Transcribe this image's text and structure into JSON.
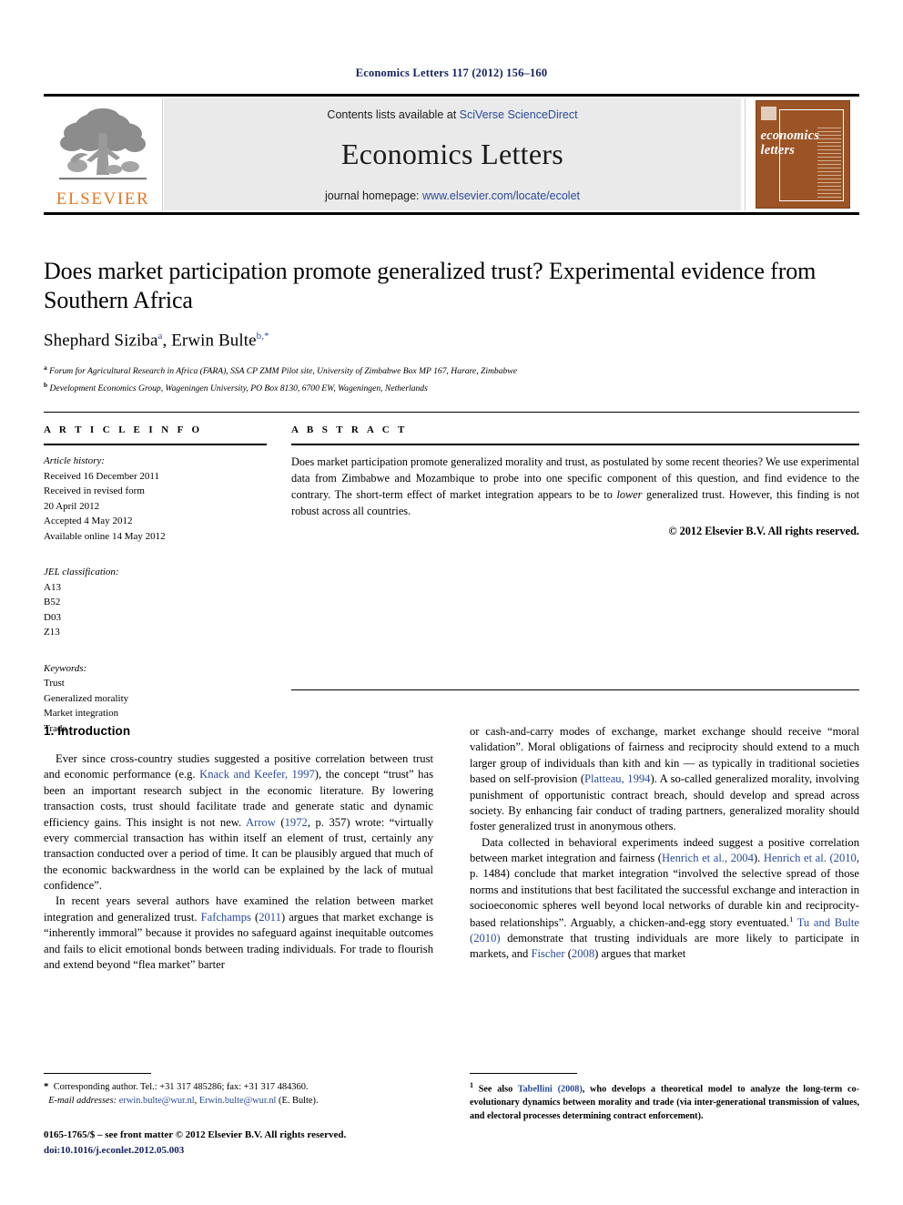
{
  "running_head": "Economics Letters 117 (2012) 156–160",
  "masthead": {
    "publisher_logo_text": "ELSEVIER",
    "contents_prefix": "Contents lists available at ",
    "contents_link": "SciVerse ScienceDirect",
    "journal_title": "Economics Letters",
    "homepage_prefix": "journal homepage: ",
    "homepage_url": "www.elsevier.com/locate/ecolet",
    "cover_title_line1": "economics",
    "cover_title_line2": "letters",
    "cover_color": "#9c5426",
    "link_color": "#2a4b9b",
    "logo_color": "#E87722"
  },
  "article": {
    "title": "Does market participation promote generalized trust? Experimental evidence from Southern Africa",
    "authors_plain": "Shephard Siziba a, Erwin Bulte b,*",
    "author1_name": "Shephard Siziba",
    "author1_sup": "a",
    "author2_name": "Erwin Bulte",
    "author2_sup": "b,*",
    "affiliation_a_marker": "a",
    "affiliation_a": "Forum for Agricultural Research in Africa (FARA), SSA CP ZMM Pilot site, University of Zimbabwe Box MP 167, Harare, Zimbabwe",
    "affiliation_b_marker": "b",
    "affiliation_b": "Development Economics Group, Wageningen University, PO Box 8130, 6700 EW, Wageningen, Netherlands"
  },
  "article_info": {
    "heading": "A R T I C L E   I N F O",
    "history_label": "Article history:",
    "history": [
      "Received 16 December 2011",
      "Received in revised form",
      "20 April 2012",
      "Accepted 4 May 2012",
      "Available online 14 May 2012"
    ],
    "jel_label": "JEL classification:",
    "jel_codes": [
      "A13",
      "B52",
      "D03",
      "Z13"
    ],
    "keywords_label": "Keywords:",
    "keywords": [
      "Trust",
      "Generalized morality",
      "Market integration",
      "Trade"
    ]
  },
  "abstract": {
    "heading": "A B S T R A C T",
    "text_part1": "Does market participation promote generalized morality and trust, as postulated by some recent theories? We use experimental data from Zimbabwe and Mozambique to probe into one specific component of this question, and find evidence to the contrary. The short-term effect of market integration appears to be to ",
    "text_italic": "lower",
    "text_part2": " generalized trust. However, this finding is not robust across all countries.",
    "copyright": "© 2012 Elsevier B.V. All rights reserved."
  },
  "body": {
    "section1_heading": "1. Introduction",
    "left_para1": {
      "seg1": "Ever since cross-country studies suggested a positive correlation between trust and economic performance (e.g. ",
      "cit1": "Knack and Keefer, 1997",
      "seg2": "), the concept “trust” has been an important research subject in the economic literature. By lowering transaction costs, trust should facilitate trade and generate static and dynamic efficiency gains. This insight is not new. ",
      "cit2": "Arrow",
      "seg3": " (",
      "cit3": "1972",
      "seg4": ", p. 357) wrote: “virtually every commercial transaction has within itself an element of trust, certainly any transaction conducted over a period of time. It can be plausibly argued that much of the economic backwardness in the world can be explained by the lack of mutual confidence”."
    },
    "left_para2": {
      "seg1": "In recent years several authors have examined the relation between market integration and generalized trust. ",
      "cit1": "Fafchamps",
      "seg2": " (",
      "cit2": "2011",
      "seg3": ") argues that market exchange is “inherently immoral” because it provides no safeguard against inequitable outcomes and fails to elicit emotional bonds between trading individuals. For trade to flourish and extend beyond “flea market” barter"
    },
    "right_para1": {
      "seg1": "or cash-and-carry modes of exchange, market exchange should receive “moral validation”. Moral obligations of fairness and reciprocity should extend to a much larger group of individuals than kith and kin — as typically in traditional societies based on self-provision (",
      "cit1": "Platteau, 1994",
      "seg2": "). A so-called generalized morality, involving punishment of opportunistic contract breach, should develop and spread across society. By enhancing fair conduct of trading partners, generalized morality should foster generalized trust in anonymous others."
    },
    "right_para2": {
      "seg1": "Data collected in behavioral experiments indeed suggest a positive correlation between market integration and fairness (",
      "cit1": "Henrich et al., 2004",
      "seg2": "). ",
      "cit2": "Henrich et al. (2010",
      "seg3": ", p. 1484) conclude that market integration “involved the selective spread of those norms and institutions that best facilitated the successful exchange and interaction in socioeconomic spheres well beyond local networks of durable kin and reciprocity-based relationships”. Arguably, a chicken-and-egg story eventuated.",
      "fnref": "1",
      "seg4": " ",
      "cit3": "Tu and Bulte (2010)",
      "seg5": " demonstrate that trusting individuals are more likely to participate in markets, and ",
      "cit4": "Fischer",
      "seg6": " (",
      "cit5": "2008",
      "seg7": ") argues that market"
    }
  },
  "footer": {
    "corresponding_marker": "*",
    "corresponding_text": "Corresponding author. Tel.: +31 317 485286; fax: +31 317 484360.",
    "email_label": "E-mail addresses:",
    "email1": "erwin.bulte@wur.nl",
    "email_sep": ", ",
    "email2": "Erwin.bulte@wur.nl",
    "email_suffix": " (E. Bulte).",
    "imprint_line": "0165-1765/$ – see front matter © 2012 Elsevier B.V. All rights reserved.",
    "doi_line": "doi:10.1016/j.econlet.2012.05.003",
    "footnote1_marker": "1",
    "footnote1_seg1": " See also ",
    "footnote1_cit": "Tabellini (2008)",
    "footnote1_seg2": ", who develops a theoretical model to analyze the long-term co-evolutionary dynamics between morality and trade (via inter-generational transmission of values, and electoral processes determining contract enforcement)."
  }
}
